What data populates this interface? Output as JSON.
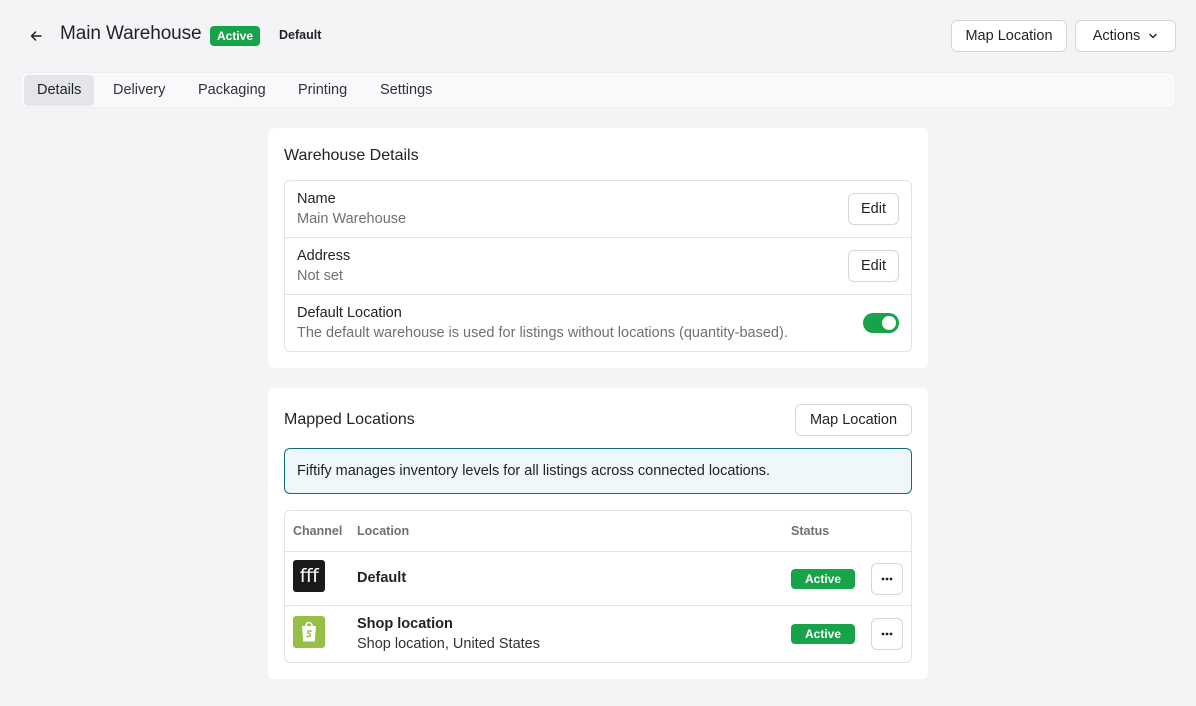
{
  "header": {
    "title": "Main Warehouse",
    "status_badge": "Active",
    "default_label": "Default",
    "map_location_button": "Map Location",
    "actions_button": "Actions"
  },
  "tabs": [
    {
      "label": "Details",
      "active": true
    },
    {
      "label": "Delivery",
      "active": false
    },
    {
      "label": "Packaging",
      "active": false
    },
    {
      "label": "Printing",
      "active": false
    },
    {
      "label": "Settings",
      "active": false
    }
  ],
  "warehouse_details": {
    "title": "Warehouse Details",
    "name_label": "Name",
    "name_value": "Main Warehouse",
    "address_label": "Address",
    "address_value": "Not set",
    "edit_label": "Edit",
    "default_location_label": "Default Location",
    "default_location_description": "The default warehouse is used for listings without locations (quantity-based).",
    "default_location_enabled": true
  },
  "mapped_locations": {
    "title": "Mapped Locations",
    "map_location_button": "Map Location",
    "info_banner": "Fiftify manages inventory levels for all listings across connected locations.",
    "columns": [
      "Channel",
      "Location",
      "Status"
    ],
    "rows": [
      {
        "channel_icon": "fiftify-logo-icon",
        "channel_glyph": "fff",
        "location": "Default",
        "sublocation": "",
        "status": "Active"
      },
      {
        "channel_icon": "shopify-logo-icon",
        "channel_glyph": "",
        "location": "Shop location",
        "sublocation": "Shop location, United States",
        "status": "Active"
      }
    ]
  },
  "colors": {
    "accent_green": "#16a34a",
    "banner_border": "#0f6f7c",
    "banner_bg": "#eff7fb",
    "shopify_green": "#95bf47",
    "page_bg": "#f3f4f6"
  }
}
